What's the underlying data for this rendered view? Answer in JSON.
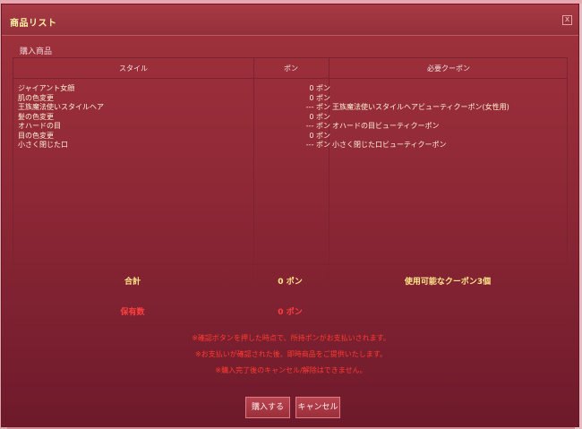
{
  "window": {
    "title": "商品リスト",
    "close_label": "x"
  },
  "section_label": "購入商品",
  "table": {
    "headers": {
      "style": "スタイル",
      "pon": "ポン",
      "coupon": "必要クーポン"
    },
    "rows": [
      {
        "style": "ジャイアント女顔",
        "pon": "0 ポン",
        "coupon": ""
      },
      {
        "style": "肌の色変更",
        "pon": "0 ポン",
        "coupon": ""
      },
      {
        "style": "王族魔法使いスタイルヘア",
        "pon": "--- ポン",
        "coupon": "王族魔法使いスタイルヘアビューティクーポン(女性用)"
      },
      {
        "style": "髪の色変更",
        "pon": "0 ポン",
        "coupon": ""
      },
      {
        "style": "オハードの目",
        "pon": "--- ポン",
        "coupon": "オハードの目ビューティクーポン"
      },
      {
        "style": "目の色変更",
        "pon": "0 ポン",
        "coupon": ""
      },
      {
        "style": "小さく閉じた口",
        "pon": "--- ポン",
        "coupon": "小さく閉じた口ビューティクーポン"
      }
    ]
  },
  "summary": {
    "total_label": "合計",
    "total_value": "0 ポン",
    "coupons_available": "使用可能なクーポン3個",
    "owned_label": "保有数",
    "owned_value": "0 ポン"
  },
  "notices": [
    "※確認ボタンを押した時点で、所持ポンがお支払いされます。",
    "※お支払いが確認された後、即時商品をご提供いたします。",
    "※購入完了後のキャンセル/解除はできません。"
  ],
  "buttons": {
    "buy": "購入する",
    "cancel": "キャンセル"
  },
  "colors": {
    "title_text": "#fff3a8",
    "summary_text": "#ffe68a",
    "owned_text": "#ff4040",
    "notice_text": "#ff3b30"
  }
}
